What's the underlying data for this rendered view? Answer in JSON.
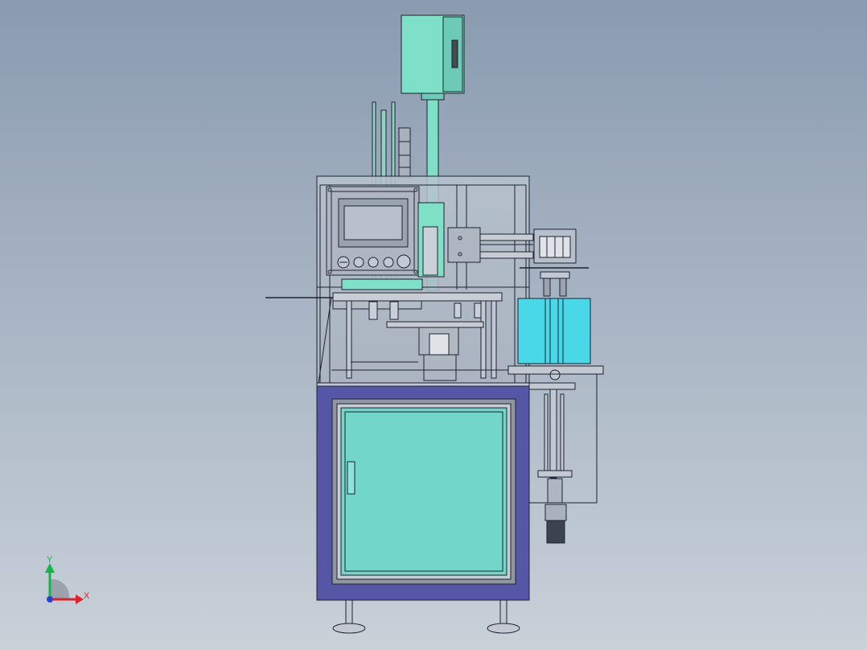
{
  "viewport": {
    "background_top": "#8a9bb0",
    "background_bottom": "#c9d1d9"
  },
  "colors": {
    "cabinet_blue": "#5656a6",
    "door_teal": "#72d6c8",
    "hmi_teal": "#7fe0c8",
    "cylinder_cyan": "#48d8e8",
    "frame_glass": "#b6c0cc",
    "line": "#1e2230"
  },
  "triad": {
    "x_label": "X",
    "y_label": "Y"
  }
}
